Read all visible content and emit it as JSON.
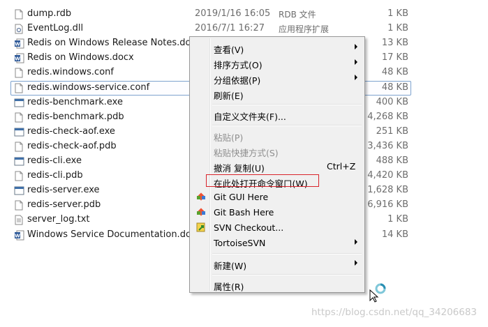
{
  "files": [
    {
      "name": "dump.rdb",
      "date": "2019/1/16 16:05",
      "type": "RDB 文件",
      "size": "1 KB",
      "icon": "file-icon"
    },
    {
      "name": "EventLog.dll",
      "date": "2016/7/1 16:27",
      "type": "应用程序扩展",
      "size": "1 KB",
      "icon": "dll-icon"
    },
    {
      "name": "Redis on Windows Release Notes.do...",
      "date": "",
      "type": "",
      "size": "13 KB",
      "icon": "word-doc-icon"
    },
    {
      "name": "Redis on Windows.docx",
      "date": "",
      "type": "",
      "size": "17 KB",
      "icon": "word-doc-icon"
    },
    {
      "name": "redis.windows.conf",
      "date": "",
      "type": "",
      "size": "48 KB",
      "icon": "file-icon"
    },
    {
      "name": "redis.windows-service.conf",
      "date": "",
      "type": "",
      "size": "48 KB",
      "icon": "file-icon"
    },
    {
      "name": "redis-benchmark.exe",
      "date": "",
      "type": "",
      "size": "400 KB",
      "icon": "exe-icon"
    },
    {
      "name": "redis-benchmark.pdb",
      "date": "",
      "type": "",
      "size": "4,268 KB",
      "icon": "file-icon"
    },
    {
      "name": "redis-check-aof.exe",
      "date": "",
      "type": "",
      "size": "251 KB",
      "icon": "exe-icon"
    },
    {
      "name": "redis-check-aof.pdb",
      "date": "",
      "type": "",
      "size": "3,436 KB",
      "icon": "file-icon"
    },
    {
      "name": "redis-cli.exe",
      "date": "",
      "type": "",
      "size": "488 KB",
      "icon": "exe-icon"
    },
    {
      "name": "redis-cli.pdb",
      "date": "",
      "type": "",
      "size": "4,420 KB",
      "icon": "file-icon"
    },
    {
      "name": "redis-server.exe",
      "date": "",
      "type": "",
      "size": "1,628 KB",
      "icon": "exe-icon"
    },
    {
      "name": "redis-server.pdb",
      "date": "",
      "type": "",
      "size": "6,916 KB",
      "icon": "file-icon"
    },
    {
      "name": "server_log.txt",
      "date": "",
      "type": "",
      "size": "1 KB",
      "icon": "text-file-icon"
    },
    {
      "name": "Windows Service Documentation.docx",
      "date": "",
      "type": "",
      "size": "14 KB",
      "icon": "word-doc-icon"
    }
  ],
  "menu": {
    "view": "查看(V)",
    "sort_by": "排序方式(O)",
    "group_by": "分组依据(P)",
    "refresh": "刷新(E)",
    "customize_folder": "自定义文件夹(F)...",
    "paste": "粘贴(P)",
    "paste_shortcut": "粘贴快捷方式(S)",
    "undo_copy": "撤消 复制(U)",
    "undo_shortcut": "Ctrl+Z",
    "open_cmd_here": "在此处打开命令窗口(W)",
    "git_gui": "Git GUI Here",
    "git_bash": "Git Bash Here",
    "svn_checkout": "SVN Checkout...",
    "tortoise_svn": "TortoiseSVN",
    "new": "新建(W)",
    "properties": "属性(R)"
  },
  "colors": {
    "highlight_outline": "#7da2ce",
    "red_annotation": "#d9232b"
  },
  "watermark": "https://blog.csdn.net/qq_34206683"
}
